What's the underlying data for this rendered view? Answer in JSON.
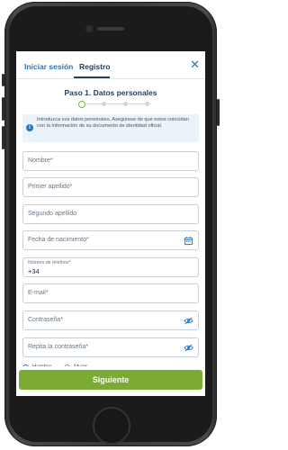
{
  "header": {
    "tabs": [
      {
        "label": "Iniciar sesión",
        "active": false
      },
      {
        "label": "Registro",
        "active": true
      }
    ],
    "close_icon": "close-icon"
  },
  "step": {
    "title": "Paso 1. Datos personales",
    "current": 1,
    "total": 4
  },
  "info": {
    "text": "Introduzca sus datos personales. Asegúrese de que estos coincidan con la información de su documento de identidad oficial.",
    "icon": "info-icon"
  },
  "form": {
    "nombre": {
      "placeholder": "Nombre*"
    },
    "primer_apellido": {
      "placeholder": "Primer apellido*"
    },
    "segundo_apellido": {
      "placeholder": "Segundo apellido"
    },
    "fecha_nacimiento": {
      "placeholder": "Fecha de nacimiento*",
      "icon": "calendar-icon"
    },
    "telefono": {
      "label": "Número de teléfono*",
      "value": "+34"
    },
    "email": {
      "placeholder": "E-mail*"
    },
    "password": {
      "placeholder": "Contraseña*",
      "icon": "eye-off-icon"
    },
    "password_repeat": {
      "placeholder": "Repita la contraseña*",
      "icon": "eye-off-icon"
    },
    "gender": {
      "options": [
        "Hombre",
        "Mujer"
      ],
      "selected": "Hombre"
    }
  },
  "footer": {
    "next_label": "Siguiente"
  },
  "colors": {
    "accent": "#2a76b5",
    "heading": "#1f3f68",
    "primary_button": "#7bab32",
    "info_bg": "#eaf3fa"
  }
}
